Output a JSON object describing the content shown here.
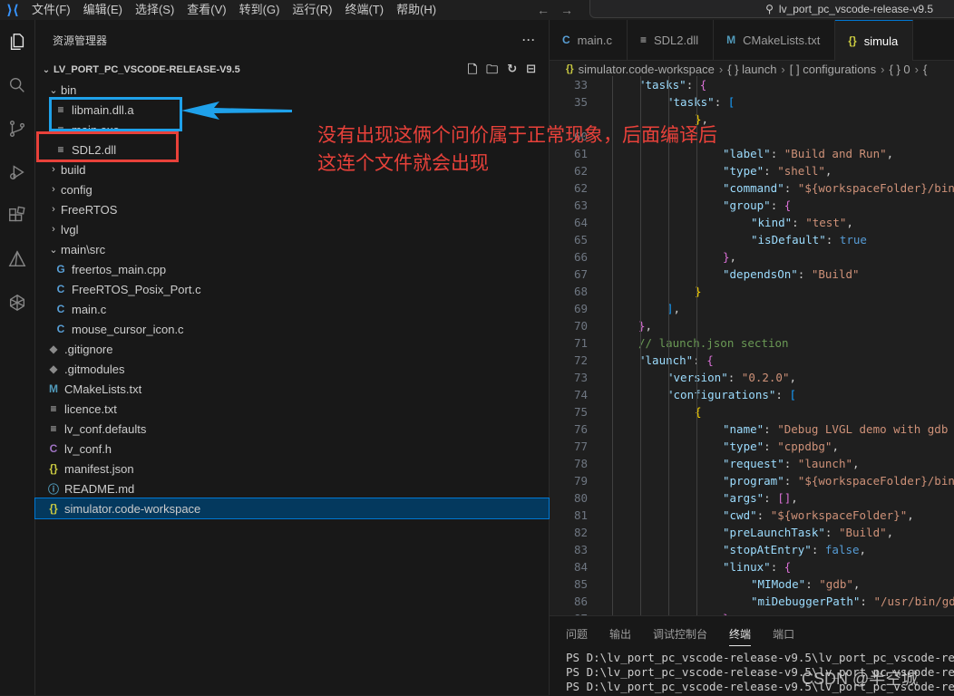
{
  "titlebar": {
    "menus": [
      "文件(F)",
      "编辑(E)",
      "选择(S)",
      "查看(V)",
      "转到(G)",
      "运行(R)",
      "终端(T)",
      "帮助(H)"
    ],
    "search_text": "lv_port_pc_vscode-release-v9.5"
  },
  "explorer": {
    "header": "资源管理器",
    "more": "···",
    "root": "LV_PORT_PC_VSCODE-RELEASE-V9.5",
    "items": [
      {
        "label": "bin",
        "depth": 0,
        "type": "folder",
        "expanded": true
      },
      {
        "label": "libmain.dll.a",
        "depth": 1,
        "type": "file",
        "icon": "≡"
      },
      {
        "label": "main.exe",
        "depth": 1,
        "type": "file",
        "icon": "≡"
      },
      {
        "label": "SDL2.dll",
        "depth": 1,
        "type": "file",
        "icon": "≡"
      },
      {
        "label": "build",
        "depth": 0,
        "type": "folder",
        "expanded": false
      },
      {
        "label": "config",
        "depth": 0,
        "type": "folder",
        "expanded": false
      },
      {
        "label": "FreeRTOS",
        "depth": 0,
        "type": "folder",
        "expanded": false
      },
      {
        "label": "lvgl",
        "depth": 0,
        "type": "folder",
        "expanded": false
      },
      {
        "label": "main\\src",
        "depth": 0,
        "type": "folder",
        "expanded": true
      },
      {
        "label": "freertos_main.cpp",
        "depth": 1,
        "type": "file",
        "icon": "G"
      },
      {
        "label": "FreeRTOS_Posix_Port.c",
        "depth": 1,
        "type": "file",
        "icon": "C"
      },
      {
        "label": "main.c",
        "depth": 1,
        "type": "file",
        "icon": "C"
      },
      {
        "label": "mouse_cursor_icon.c",
        "depth": 1,
        "type": "file",
        "icon": "C"
      },
      {
        "label": ".gitignore",
        "depth": 0,
        "type": "file",
        "icon": "◆"
      },
      {
        "label": ".gitmodules",
        "depth": 0,
        "type": "file",
        "icon": "◆"
      },
      {
        "label": "CMakeLists.txt",
        "depth": 0,
        "type": "file",
        "icon": "M"
      },
      {
        "label": "licence.txt",
        "depth": 0,
        "type": "file",
        "icon": "≡"
      },
      {
        "label": "lv_conf.defaults",
        "depth": 0,
        "type": "file",
        "icon": "≡"
      },
      {
        "label": "lv_conf.h",
        "depth": 0,
        "type": "file",
        "icon": "C"
      },
      {
        "label": "manifest.json",
        "depth": 0,
        "type": "file",
        "icon": "{}"
      },
      {
        "label": "README.md",
        "depth": 0,
        "type": "file",
        "icon": "ⓘ"
      },
      {
        "label": "simulator.code-workspace",
        "depth": 0,
        "type": "file",
        "icon": "{}",
        "selected": true
      }
    ]
  },
  "tabs": [
    {
      "label": "main.c",
      "icon": "C"
    },
    {
      "label": "SDL2.dll",
      "icon": "≡"
    },
    {
      "label": "CMakeLists.txt",
      "icon": "M"
    },
    {
      "label": "simula",
      "icon": "{}",
      "active": true
    }
  ],
  "breadcrumb": [
    "simulator.code-workspace",
    "{ } launch",
    "[ ] configurations",
    "{ } 0",
    "{"
  ],
  "code_lines": [
    {
      "n": "33",
      "ind": 1,
      "html": "<span class='k'>\"tasks\"</span><span class='p'>: </span><span class='b2'>{</span>"
    },
    {
      "n": "35",
      "ind": 2,
      "html": "<span class='k'>\"tasks\"</span><span class='p'>: </span><span class='b3'>[</span>"
    },
    {
      "n": "",
      "ind": 3,
      "html": "<span class='b'>}</span><span class='p'>,</span>"
    },
    {
      "n": "60",
      "ind": 3,
      "html": ""
    },
    {
      "n": "61",
      "ind": 4,
      "html": "<span class='k'>\"label\"</span><span class='p'>: </span><span class='s'>\"Build and Run\"</span><span class='p'>,</span>"
    },
    {
      "n": "62",
      "ind": 4,
      "html": "<span class='k'>\"type\"</span><span class='p'>: </span><span class='s'>\"shell\"</span><span class='p'>,</span>"
    },
    {
      "n": "62",
      "ind": 4,
      "html": "<span class='k'>\"command\"</span><span class='p'>: </span><span class='s'>\"${workspaceFolder}/bin</span>"
    },
    {
      "n": "63",
      "ind": 4,
      "html": "<span class='k'>\"group\"</span><span class='p'>: </span><span class='b2'>{</span>"
    },
    {
      "n": "64",
      "ind": 5,
      "html": "<span class='k'>\"kind\"</span><span class='p'>: </span><span class='s'>\"test\"</span><span class='p'>,</span>"
    },
    {
      "n": "65",
      "ind": 5,
      "html": "<span class='k'>\"isDefault\"</span><span class='p'>: </span><span class='kw'>true</span>"
    },
    {
      "n": "66",
      "ind": 4,
      "html": "<span class='b2'>}</span><span class='p'>,</span>"
    },
    {
      "n": "67",
      "ind": 4,
      "html": "<span class='k'>\"dependsOn\"</span><span class='p'>: </span><span class='s'>\"Build\"</span>"
    },
    {
      "n": "68",
      "ind": 3,
      "html": "<span class='b'>}</span>"
    },
    {
      "n": "69",
      "ind": 2,
      "html": "<span class='b3'>]</span><span class='p'>,</span>"
    },
    {
      "n": "70",
      "ind": 1,
      "html": "<span class='b2'>}</span><span class='p'>,</span>"
    },
    {
      "n": "71",
      "ind": 1,
      "html": "<span class='cm'>// launch.json section</span>"
    },
    {
      "n": "72",
      "ind": 1,
      "html": "<span class='k'>\"launch\"</span><span class='p'>: </span><span class='b2'>{</span>"
    },
    {
      "n": "73",
      "ind": 2,
      "html": "<span class='k'>\"version\"</span><span class='p'>: </span><span class='s'>\"0.2.0\"</span><span class='p'>,</span>"
    },
    {
      "n": "74",
      "ind": 2,
      "html": "<span class='k'>\"configurations\"</span><span class='p'>: </span><span class='b3'>[</span>"
    },
    {
      "n": "75",
      "ind": 3,
      "html": "<span class='b'>{</span>"
    },
    {
      "n": "76",
      "ind": 4,
      "html": "<span class='k'>\"name\"</span><span class='p'>: </span><span class='s'>\"Debug LVGL demo with gdb</span>"
    },
    {
      "n": "77",
      "ind": 4,
      "html": "<span class='k'>\"type\"</span><span class='p'>: </span><span class='s'>\"cppdbg\"</span><span class='p'>,</span>"
    },
    {
      "n": "78",
      "ind": 4,
      "html": "<span class='k'>\"request\"</span><span class='p'>: </span><span class='s'>\"launch\"</span><span class='p'>,</span>"
    },
    {
      "n": "79",
      "ind": 4,
      "html": "<span class='k'>\"program\"</span><span class='p'>: </span><span class='s'>\"${workspaceFolder}/bin</span>"
    },
    {
      "n": "80",
      "ind": 4,
      "html": "<span class='k'>\"args\"</span><span class='p'>: </span><span class='b2'>[]</span><span class='p'>,</span>"
    },
    {
      "n": "81",
      "ind": 4,
      "html": "<span class='k'>\"cwd\"</span><span class='p'>: </span><span class='s'>\"${workspaceFolder}\"</span><span class='p'>,</span>"
    },
    {
      "n": "82",
      "ind": 4,
      "html": "<span class='k'>\"preLaunchTask\"</span><span class='p'>: </span><span class='s'>\"Build\"</span><span class='p'>,</span>"
    },
    {
      "n": "83",
      "ind": 4,
      "html": "<span class='k'>\"stopAtEntry\"</span><span class='p'>: </span><span class='kw'>false</span><span class='p'>,</span>"
    },
    {
      "n": "84",
      "ind": 4,
      "html": "<span class='k'>\"linux\"</span><span class='p'>: </span><span class='b2'>{</span>"
    },
    {
      "n": "85",
      "ind": 5,
      "html": "<span class='k'>\"MIMode\"</span><span class='p'>: </span><span class='s'>\"gdb\"</span><span class='p'>,</span>"
    },
    {
      "n": "86",
      "ind": 5,
      "html": "<span class='k'>\"miDebuggerPath\"</span><span class='p'>: </span><span class='s'>\"/usr/bin/gd</span>"
    },
    {
      "n": "87",
      "ind": 4,
      "html": "<span class='b2'>},</span>"
    }
  ],
  "panel": {
    "tabs": [
      "问题",
      "输出",
      "调试控制台",
      "终端",
      "端口"
    ],
    "active_tab": "终端",
    "terminal_lines": [
      "PS D:\\lv_port_pc_vscode-release-v9.5\\lv_port_pc_vscode-releas",
      "PS D:\\lv_port_pc_vscode-release-v9.5\\lv_port_pc_vscode-releas",
      "PS D:\\lv_port_pc_vscode-release-v9.5\\lv_port_pc_vscode-releas"
    ]
  },
  "annotation": {
    "text": "没有出现这俩个问价属于正常现象，后面编译后这连个文件就会出现",
    "color": "#e8413a",
    "box_blue": "#1fa1ea",
    "box_red": "#e8413a"
  },
  "watermark": "CSDN @半空城"
}
